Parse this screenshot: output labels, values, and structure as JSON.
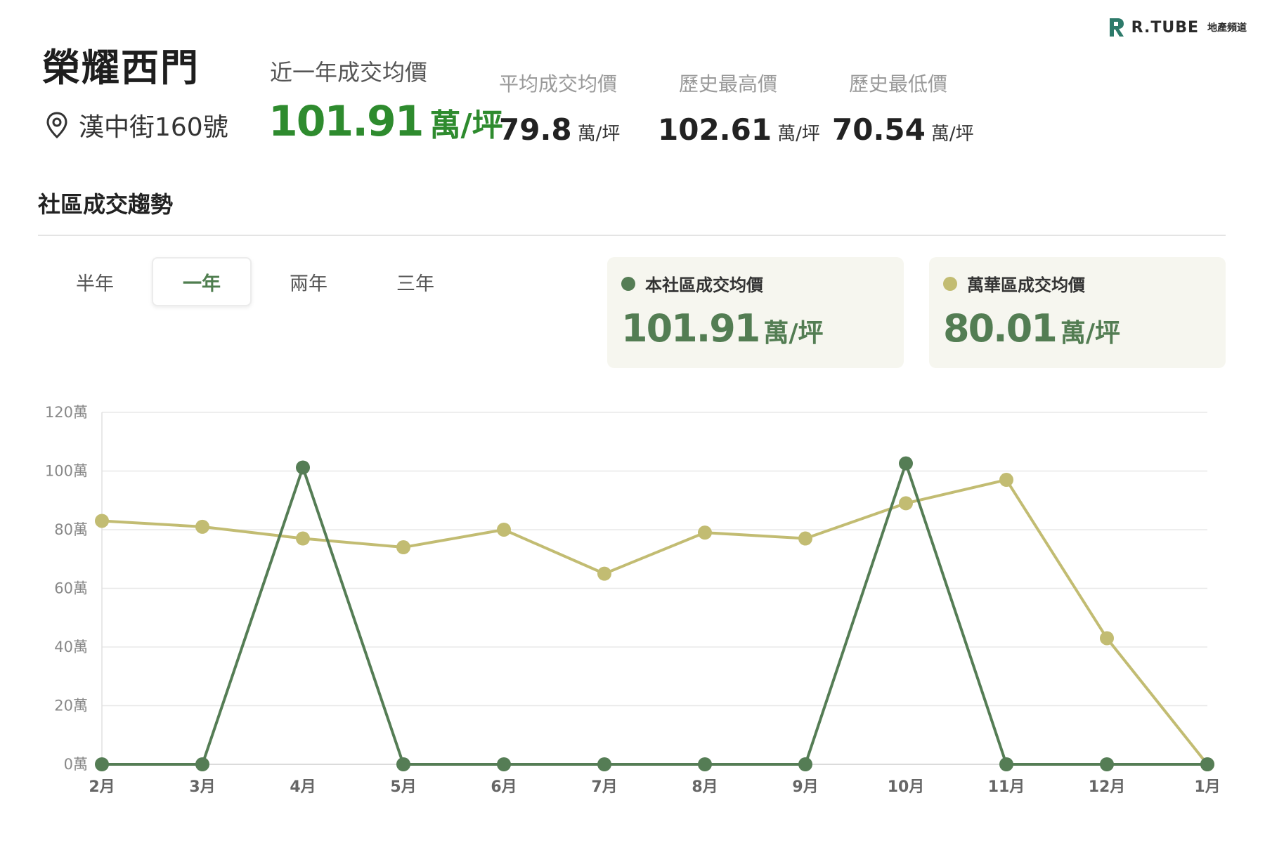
{
  "brand": {
    "name": "R.TUBE",
    "sub": "地產頻道",
    "accent": "#2d7a6a"
  },
  "community": {
    "name": "榮耀西門",
    "address": "漢中街160號"
  },
  "recent": {
    "label": "近一年成交均價",
    "value": "101.91",
    "unit": "萬/坪"
  },
  "stats": [
    {
      "label": "平均成交均價",
      "value": "79.8",
      "unit": "萬/坪"
    },
    {
      "label": "歷史最高價",
      "value": "102.61",
      "unit": "萬/坪"
    },
    {
      "label": "歷史最低價",
      "value": "70.54",
      "unit": "萬/坪"
    }
  ],
  "section_title": "社區成交趨勢",
  "tabs": [
    {
      "label": "半年",
      "active": false
    },
    {
      "label": "一年",
      "active": true
    },
    {
      "label": "兩年",
      "active": false
    },
    {
      "label": "三年",
      "active": false
    }
  ],
  "legend_cards": [
    {
      "label": "本社區成交均價",
      "value": "101.91",
      "unit": "萬/坪",
      "color": "#557d55"
    },
    {
      "label": "萬華區成交均價",
      "value": "80.01",
      "unit": "萬/坪",
      "color": "#c2bc72"
    }
  ],
  "chart_data": {
    "type": "line",
    "categories": [
      "2月",
      "3月",
      "4月",
      "5月",
      "6月",
      "7月",
      "8月",
      "9月",
      "10月",
      "11月",
      "12月",
      "1月"
    ],
    "series": [
      {
        "name": "萬華區成交均價",
        "color": "#c2bc72",
        "values": [
          83,
          81,
          77,
          74,
          80,
          65,
          79,
          77,
          89,
          97,
          43,
          0
        ]
      },
      {
        "name": "本社區成交均價",
        "color": "#557d55",
        "values": [
          0,
          0,
          101.2,
          0,
          0,
          0,
          0,
          0,
          102.6,
          0,
          0,
          0
        ]
      }
    ],
    "ylim": [
      0,
      120
    ],
    "yticks": [
      0,
      20,
      40,
      60,
      80,
      100,
      120
    ],
    "ytick_suffix": "萬",
    "grid": true,
    "legend": "top-right"
  }
}
